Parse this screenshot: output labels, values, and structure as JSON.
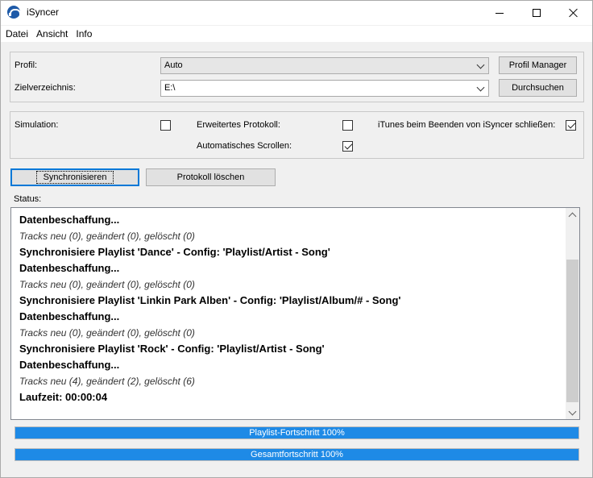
{
  "window": {
    "title": "iSyncer",
    "icon": "app-headphones-icon"
  },
  "menu": {
    "items": [
      "Datei",
      "Ansicht",
      "Info"
    ]
  },
  "profile": {
    "profile_label": "Profil:",
    "profile_value": "Auto",
    "profile_manager_button": "Profil Manager",
    "target_label": "Zielverzeichnis:",
    "target_value": "E:\\",
    "browse_button": "Durchsuchen"
  },
  "options": {
    "simulation_label": "Simulation:",
    "simulation_checked": false,
    "extended_log_label": "Erweitertes Protokoll:",
    "extended_log_checked": false,
    "close_itunes_label": "iTunes beim Beenden von iSyncer schließen:",
    "close_itunes_checked": true,
    "auto_scroll_label": "Automatisches Scrollen:",
    "auto_scroll_checked": true
  },
  "actions": {
    "sync_button": "Synchronisieren",
    "clear_log_button": "Protokoll löschen"
  },
  "status": {
    "label": "Status:",
    "lines": [
      {
        "text": "Datenbeschaffung...",
        "style": "bold"
      },
      {
        "text": "Tracks neu (0), geändert (0), gelöscht (0)",
        "style": "italic"
      },
      {
        "text": "Synchronisiere Playlist 'Dance' - Config: 'Playlist/Artist - Song'",
        "style": "bold"
      },
      {
        "text": "Datenbeschaffung...",
        "style": "bold"
      },
      {
        "text": "Tracks neu (0), geändert (0), gelöscht (0)",
        "style": "italic"
      },
      {
        "text": "Synchronisiere Playlist 'Linkin Park Alben' - Config: 'Playlist/Album/# - Song'",
        "style": "bold"
      },
      {
        "text": "Datenbeschaffung...",
        "style": "bold"
      },
      {
        "text": "Tracks neu (0), geändert (0), gelöscht (0)",
        "style": "italic"
      },
      {
        "text": "Synchronisiere Playlist 'Rock' - Config: 'Playlist/Artist - Song'",
        "style": "bold"
      },
      {
        "text": "Datenbeschaffung...",
        "style": "bold"
      },
      {
        "text": "Tracks neu (4), geändert (2), gelöscht (6)",
        "style": "italic"
      },
      {
        "text": "Laufzeit: 00:00:04",
        "style": "bold"
      }
    ]
  },
  "progress": {
    "playlist_label": "Playlist-Fortschritt 100%",
    "playlist_value": 100,
    "total_label": "Gesamtfortschritt 100%",
    "total_value": 100,
    "fill_color": "#1e8ae6"
  }
}
